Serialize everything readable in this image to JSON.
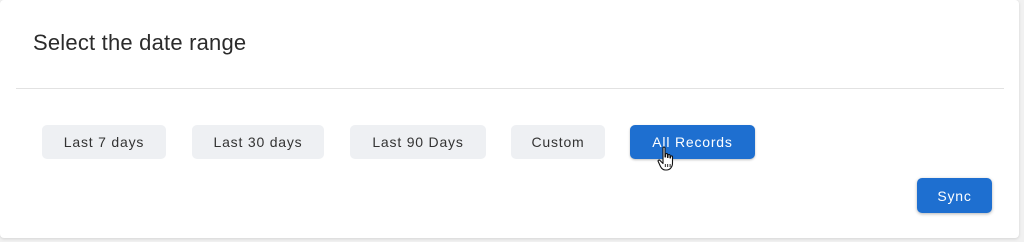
{
  "dialog": {
    "title": "Select the date range"
  },
  "date_ranges": [
    {
      "label": "Last 7 days",
      "selected": false
    },
    {
      "label": "Last 30 days",
      "selected": false
    },
    {
      "label": "Last 90 Days",
      "selected": false
    },
    {
      "label": "Custom",
      "selected": false
    },
    {
      "label": "All Records",
      "selected": true
    }
  ],
  "actions": {
    "sync_label": "Sync"
  },
  "colors": {
    "accent": "#1e6fd0",
    "chip_bg": "#eef0f3",
    "text": "#2b2b2b"
  },
  "icons": {
    "cursor": "hand-pointer-icon"
  }
}
